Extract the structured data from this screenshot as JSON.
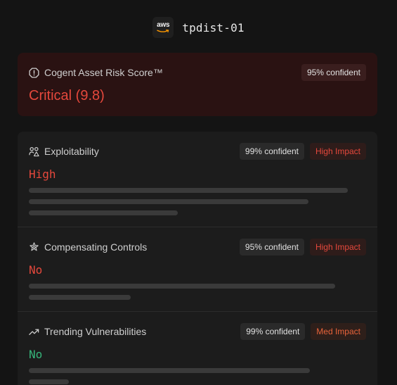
{
  "header": {
    "logo_text": "aws",
    "asset_name": "tpdist-01"
  },
  "risk_score": {
    "label": "Cogent Asset Risk Score™",
    "confidence": "95% confident",
    "value": "Critical (9.8)",
    "icon": "shield-alert-icon",
    "color": "#e5483c"
  },
  "factors": [
    {
      "label": "Exploitability",
      "icon": "people-warning-icon",
      "confidence": "99% confident",
      "impact": "High Impact",
      "value": "High",
      "value_color": "#e5483c"
    },
    {
      "label": "Compensating Controls",
      "icon": "gear-star-icon",
      "confidence": "95% confident",
      "impact": "High Impact",
      "value": "No",
      "value_color": "#e5483c"
    },
    {
      "label": "Trending Vulnerabilities",
      "icon": "trending-up-icon",
      "confidence": "99% confident",
      "impact": "Med Impact",
      "value": "No",
      "value_color": "#36b57a"
    }
  ]
}
